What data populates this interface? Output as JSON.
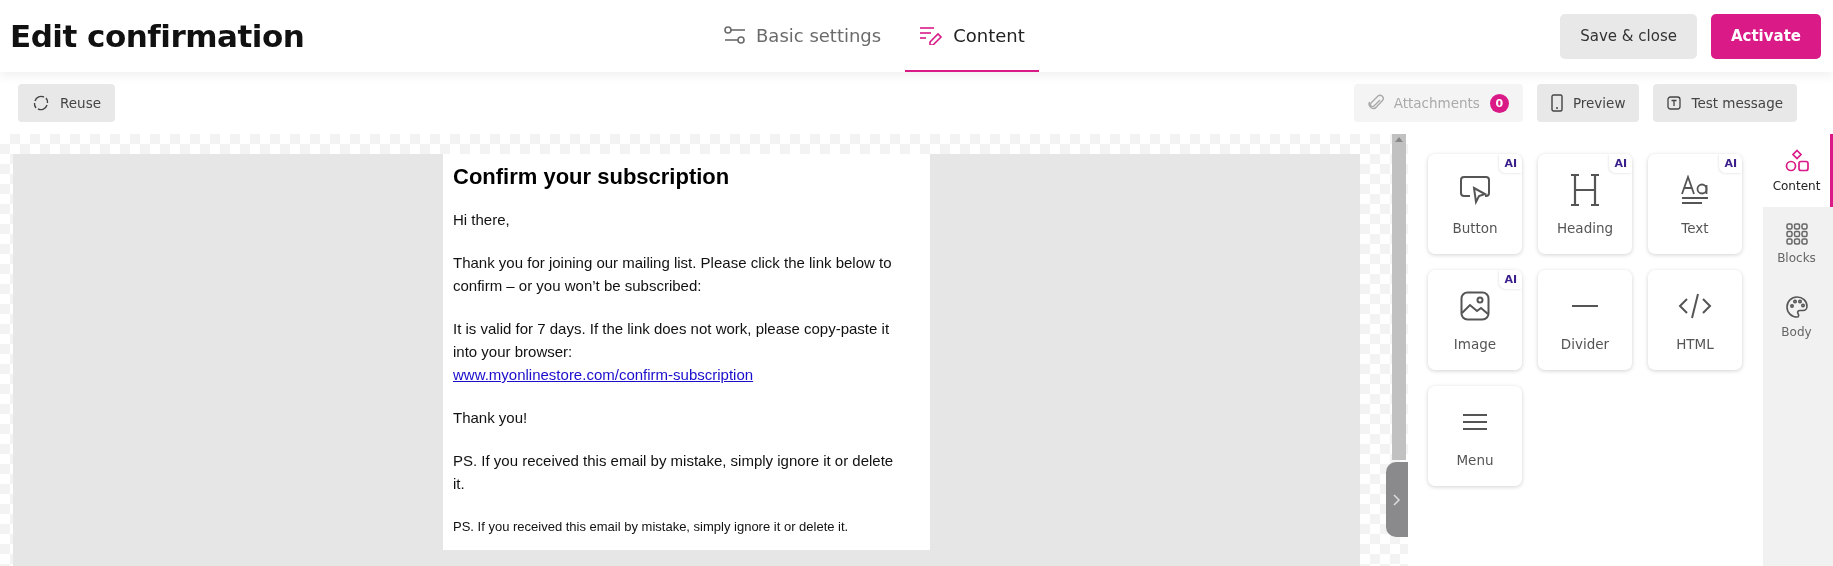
{
  "title": "Edit confirmation",
  "tabs": [
    {
      "label": "Basic settings",
      "selected": false,
      "kind": "settings"
    },
    {
      "label": "Content",
      "selected": true,
      "kind": "content"
    }
  ],
  "header_buttons": [
    {
      "label": "Save & close",
      "kind": "secondary"
    },
    {
      "label": "Activate",
      "kind": "primary"
    }
  ],
  "toolbar": {
    "reuse": "Reuse",
    "attachments": {
      "label": "Attachments",
      "count": "0",
      "disabled": true
    },
    "preview": "Preview",
    "test_message": "Test message"
  },
  "email": {
    "blocks": [
      {
        "kind": "heading",
        "text": "Confirm your subscription"
      },
      {
        "kind": "paragraph",
        "text": "Hi there,"
      },
      {
        "kind": "paragraph",
        "text": "Thank you for joining our mailing list. Please click the link below to confirm – or you won’t be subscribed:"
      },
      {
        "kind": "paragraph",
        "text": "It is valid for 7 days. If the link does not work, please copy-paste it into your browser:",
        "link": "www.myonlinestore.com/confirm-subscription"
      },
      {
        "kind": "paragraph",
        "text": "Thank you!"
      },
      {
        "kind": "paragraph",
        "text": "PS. If you received this email by mistake, simply ignore it or delete it."
      },
      {
        "kind": "small",
        "text": "PS. If you received this email by mistake, simply ignore it or delete it."
      }
    ]
  },
  "elements": [
    {
      "label": "Button",
      "kind": "button",
      "ai_badge": "AI"
    },
    {
      "label": "Heading",
      "kind": "heading",
      "ai_badge": "AI"
    },
    {
      "label": "Text",
      "kind": "text",
      "ai_badge": "AI"
    },
    {
      "label": "Image",
      "kind": "image",
      "ai_badge": "AI"
    },
    {
      "label": "Divider",
      "kind": "divider"
    },
    {
      "label": "HTML",
      "kind": "html"
    },
    {
      "label": "Menu",
      "kind": "menu"
    }
  ],
  "side_tabs": [
    {
      "label": "Content",
      "kind": "content",
      "selected": true
    },
    {
      "label": "Blocks",
      "kind": "blocks",
      "selected": false
    },
    {
      "label": "Body",
      "kind": "body",
      "selected": false
    }
  ]
}
